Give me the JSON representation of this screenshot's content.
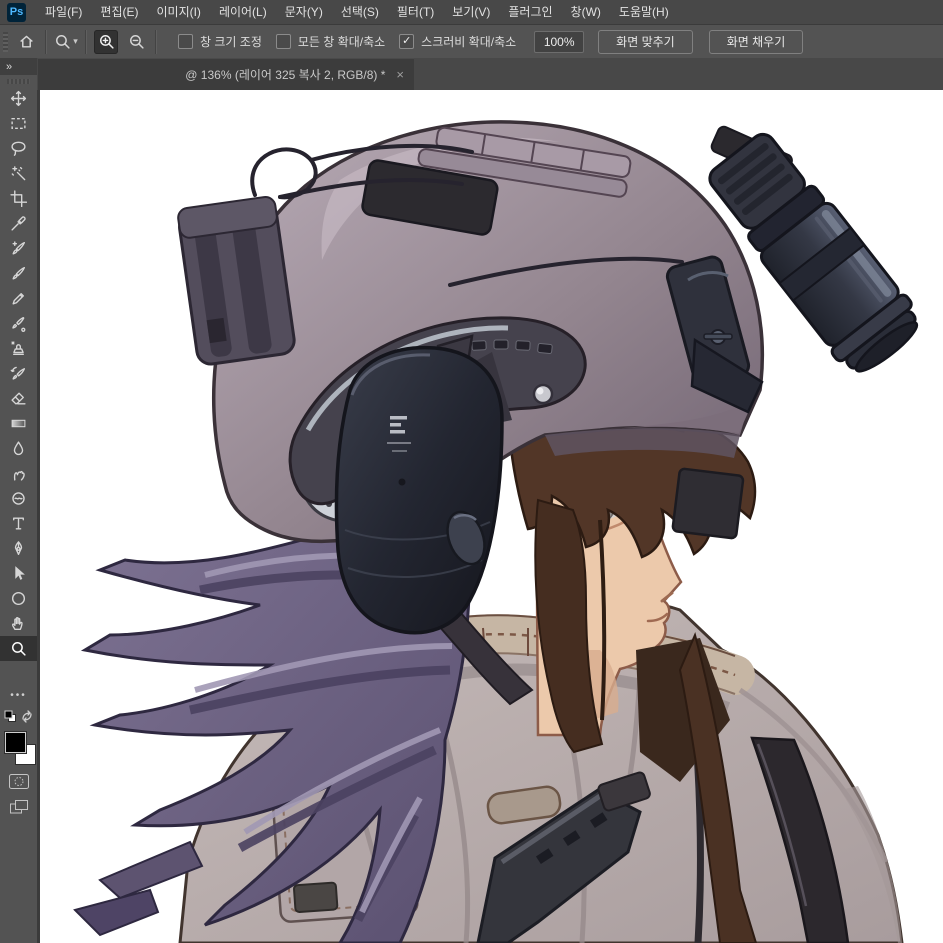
{
  "app": {
    "logo": "Ps"
  },
  "menu_bar": {
    "items": [
      {
        "id": "file",
        "label": "파일(F)"
      },
      {
        "id": "edit",
        "label": "편집(E)"
      },
      {
        "id": "image",
        "label": "이미지(I)"
      },
      {
        "id": "layer",
        "label": "레이어(L)"
      },
      {
        "id": "type",
        "label": "문자(Y)"
      },
      {
        "id": "select",
        "label": "선택(S)"
      },
      {
        "id": "filter",
        "label": "필터(T)"
      },
      {
        "id": "view",
        "label": "보기(V)"
      },
      {
        "id": "plugins",
        "label": "플러그인"
      },
      {
        "id": "window",
        "label": "창(W)"
      },
      {
        "id": "help",
        "label": "도움말(H)"
      }
    ]
  },
  "options_bar": {
    "check_glyph": "✓",
    "caret_glyph": "▾",
    "checkboxes": [
      {
        "label": "창 크기 조정",
        "checked": false
      },
      {
        "label": "모든 창 확대/축소",
        "checked": false
      },
      {
        "label": "스크러비 확대/축소",
        "checked": true
      }
    ],
    "zoom_value": "100%",
    "fit_screen_label": "화면 맞추기",
    "fill_screen_label": "화면 채우기"
  },
  "tab_bar": {
    "tab": {
      "title": "@ 136% (레이어 325 복사 2, RGB/8) *",
      "close_glyph": "×",
      "active": true
    }
  },
  "toolbar": {
    "expand_glyph": "»",
    "dots_glyph": "•••",
    "active_tool": "zoom",
    "tools": [
      {
        "name": "move"
      },
      {
        "name": "rectangular-marquee"
      },
      {
        "name": "lasso"
      },
      {
        "name": "magic-wand"
      },
      {
        "name": "crop"
      },
      {
        "name": "eyedropper"
      },
      {
        "name": "spot-healing-brush"
      },
      {
        "name": "brush"
      },
      {
        "name": "pencil"
      },
      {
        "name": "mixer-brush"
      },
      {
        "name": "clone-stamp"
      },
      {
        "name": "history-brush"
      },
      {
        "name": "eraser"
      },
      {
        "name": "gradient"
      },
      {
        "name": "blur"
      },
      {
        "name": "smudge"
      },
      {
        "name": "sponge"
      },
      {
        "name": "type"
      },
      {
        "name": "pen"
      },
      {
        "name": "path-selection"
      },
      {
        "name": "ellipse"
      },
      {
        "name": "hand"
      },
      {
        "name": "zoom"
      }
    ],
    "colors": {
      "foreground": "#000000",
      "background": "#ffffff"
    }
  },
  "canvas": {
    "document_zoom": "136%",
    "background": "#ffffff",
    "artwork_palette": {
      "helmet": "#93858f",
      "helmet_highlight": "#c9bcc7",
      "velcro_patch": "#2c2a2f",
      "rail_dark": "#45424d",
      "rail_light": "#cdd1d8",
      "earcup": "#232631",
      "nvg_tube": "#383c49",
      "skin": "#ecc9ab",
      "hair_front": "#523627",
      "hair_ponytail": "#6f6483",
      "jacket": "#b9adae",
      "collar_ruffle": "#c6b6a4",
      "strap": "#2c282d"
    }
  }
}
